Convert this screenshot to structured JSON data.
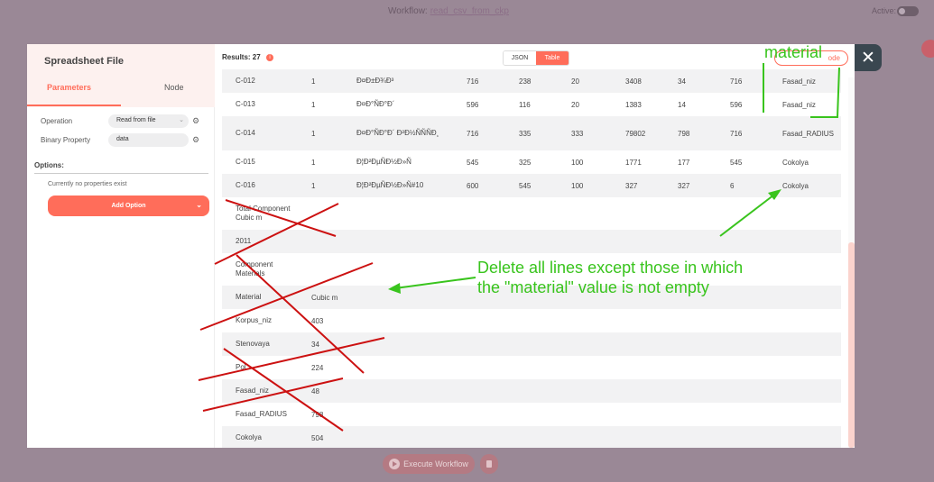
{
  "topbar": {
    "workflow_label": "Workflow:",
    "workflow_name": "read_csv_from_ckp",
    "active_label": "Active:"
  },
  "footer": {
    "execute_label": "Execute Workflow"
  },
  "left_panel": {
    "title": "Spreadsheet File",
    "tabs": [
      "Parameters",
      "Node"
    ],
    "operation_label": "Operation",
    "operation_value": "Read from file",
    "binary_label": "Binary Property",
    "binary_value": "data",
    "options_label": "Options:",
    "no_properties": "Currently no properties exist",
    "add_option_label": "Add Option"
  },
  "right_panel": {
    "results_label": "Results: 27",
    "info_icon": "i",
    "view_toggle": [
      "JSON",
      "Table"
    ],
    "active_view": "Table",
    "node_button_label": "ode",
    "rows": [
      {
        "cells": [
          "C-012",
          "1",
          "Ð¤Ð±Ð¾Ð³",
          "716",
          "238",
          "20",
          "3408",
          "34",
          "716",
          "Fasad_niz"
        ],
        "h": 26
      },
      {
        "cells": [
          "C-013",
          "1",
          "Ð¤Ð°ÑÐ°Ð´",
          "596",
          "116",
          "20",
          "1383",
          "14",
          "596",
          "Fasad_niz"
        ],
        "h": 26
      },
      {
        "cells": [
          "C-014",
          "1",
          "Ð¤Ð°ÑÐ°Ð´ Ð²Ð½ÑÑÑÐ¸",
          "716",
          "335",
          "333",
          "79802",
          "798",
          "716",
          "Fasad_RADIUS"
        ],
        "h": 38
      },
      {
        "cells": [
          "C-015",
          "1",
          "Ð¦Ð²ÐµÑÐ½Ð»Ñ",
          "545",
          "325",
          "100",
          "1771",
          "177",
          "545",
          "Cokolya"
        ],
        "h": 26
      },
      {
        "cells": [
          "C-016",
          "1",
          "Ð¦Ð²ÐµÑÐ½Ð»Ñ#10",
          "600",
          "545",
          "100",
          "327",
          "327",
          "6",
          "Cokolya"
        ],
        "h": 26
      },
      {
        "cells": [
          "Total Component Cubic m",
          "",
          "",
          "",
          "",
          "",
          "",
          "",
          "",
          ""
        ],
        "h": 36
      },
      {
        "cells": [
          "2011",
          "",
          "",
          "",
          "",
          "",
          "",
          "",
          "",
          ""
        ],
        "h": 26
      },
      {
        "cells": [
          "Component Materials",
          "",
          "",
          "",
          "",
          "",
          "",
          "",
          "",
          ""
        ],
        "h": 36
      },
      {
        "cells": [
          "Material",
          "Cubic m",
          "",
          "",
          "",
          "",
          "",
          "",
          "",
          ""
        ],
        "h": 26
      },
      {
        "cells": [
          "Korpus_niz",
          "403",
          "",
          "",
          "",
          "",
          "",
          "",
          "",
          ""
        ],
        "h": 26
      },
      {
        "cells": [
          "Stenovaya",
          "34",
          "",
          "",
          "",
          "",
          "",
          "",
          "",
          ""
        ],
        "h": 26
      },
      {
        "cells": [
          "Pol",
          "224",
          "",
          "",
          "",
          "",
          "",
          "",
          "",
          ""
        ],
        "h": 26
      },
      {
        "cells": [
          "Fasad_niz",
          "48",
          "",
          "",
          "",
          "",
          "",
          "",
          "",
          ""
        ],
        "h": 26
      },
      {
        "cells": [
          "Fasad_RADIUS",
          "798",
          "",
          "",
          "",
          "",
          "",
          "",
          "",
          ""
        ],
        "h": 26
      },
      {
        "cells": [
          "Cokolya",
          "504",
          "",
          "",
          "",
          "",
          "",
          "",
          "",
          ""
        ],
        "h": 26
      }
    ]
  },
  "annotations": {
    "material_label": "material",
    "instruction_line1": "Delete all lines except those in which",
    "instruction_line2": "the \"material\" value is not empty",
    "green": "#39c41d",
    "red": "#cc1111"
  },
  "colors": {
    "accent": "#ff6d5a",
    "overlay": "#9a8896",
    "close_bg": "#3a4750"
  }
}
